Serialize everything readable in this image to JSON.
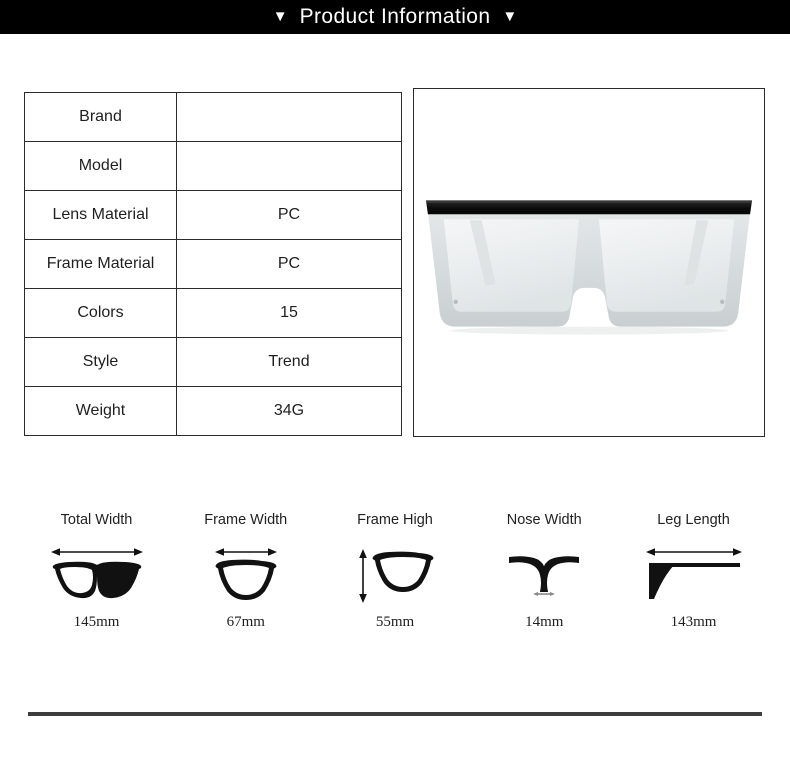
{
  "header": {
    "title": "Product Information",
    "caret_left": "▼",
    "caret_right": "▼",
    "background_color": "#000000",
    "text_color": "#ffffff"
  },
  "spec_table": {
    "rows": [
      {
        "label": "Brand",
        "value": ""
      },
      {
        "label": "Model",
        "value": ""
      },
      {
        "label": "Lens Material",
        "value": "PC"
      },
      {
        "label": "Frame Material",
        "value": "PC"
      },
      {
        "label": "Colors",
        "value": "15"
      },
      {
        "label": "Style",
        "value": "Trend"
      },
      {
        "label": "Weight",
        "value": "34G"
      }
    ],
    "border_color": "#2b2b2b"
  },
  "product_image": {
    "alt": "flat-top oversized square sunglasses",
    "brow_bar_color": "#111111",
    "frame_color": "#d8dcdd",
    "lens_color": "#eef1f2",
    "border_color": "#2b2b2b"
  },
  "measurements": [
    {
      "label": "Total Width",
      "value": "145mm",
      "icon": "glasses-full-icon",
      "arrow": "horizontal"
    },
    {
      "label": "Frame Width",
      "value": "67mm",
      "icon": "lens-outline-icon",
      "arrow": "horizontal"
    },
    {
      "label": "Frame High",
      "value": "55mm",
      "icon": "lens-outline-icon",
      "arrow": "vertical"
    },
    {
      "label": "Nose Width",
      "value": "14mm",
      "icon": "nose-bridge-icon",
      "arrow": "horizontal-short"
    },
    {
      "label": "Leg Length",
      "value": "143mm",
      "icon": "temple-arm-icon",
      "arrow": "horizontal"
    }
  ],
  "divider": {
    "color": "#3d3d3d"
  }
}
